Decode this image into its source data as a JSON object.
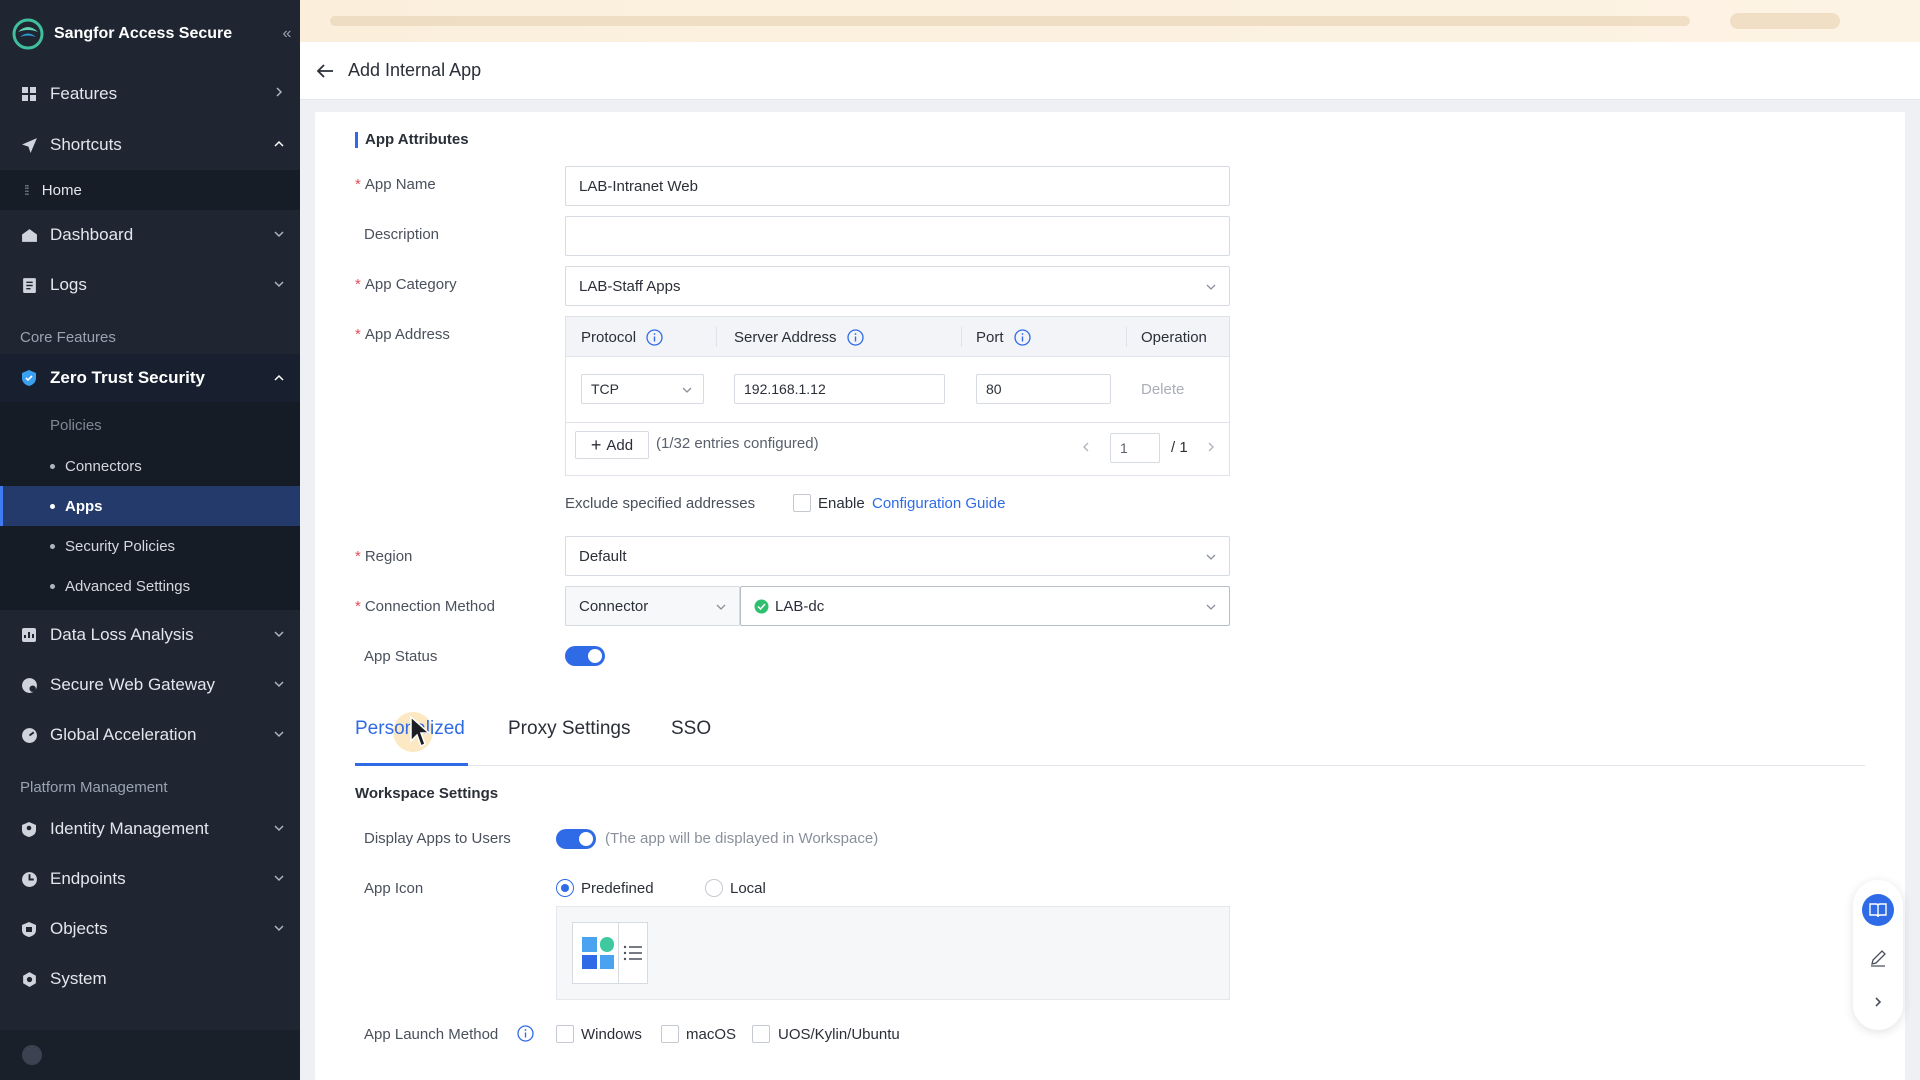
{
  "app": {
    "brand": "Sangfor Access Secure"
  },
  "sidebar": {
    "features": "Features",
    "shortcuts": "Shortcuts",
    "home": "Home",
    "dashboard": "Dashboard",
    "logs": "Logs",
    "core_section": "Core Features",
    "zero_trust": "Zero Trust Security",
    "policies": "Policies",
    "connectors": "Connectors",
    "apps": "Apps",
    "security_policies": "Security Policies",
    "advanced_settings": "Advanced Settings",
    "data_loss": "Data Loss Analysis",
    "swg": "Secure Web Gateway",
    "global_accel": "Global Acceleration",
    "platform_section": "Platform Management",
    "identity": "Identity Management",
    "endpoints": "Endpoints",
    "objects": "Objects",
    "system": "System"
  },
  "header": {
    "title": "Add Internal App"
  },
  "form": {
    "section_title": "App Attributes",
    "app_name_label": "App Name",
    "app_name_value": "LAB-Intranet Web",
    "description_label": "Description",
    "description_value": "",
    "category_label": "App Category",
    "category_value": "LAB-Staff Apps",
    "address_label": "App Address",
    "table_headers": {
      "protocol": "Protocol",
      "server_address": "Server Address",
      "port": "Port",
      "operation": "Operation"
    },
    "row": {
      "protocol": "TCP",
      "server_address": "192.168.1.12",
      "port": "80",
      "delete": "Delete"
    },
    "add_label": "Add",
    "entries_text": "(1/32 entries configured)",
    "page_current": "1",
    "page_total": "/ 1",
    "exclude_label": "Exclude specified addresses",
    "enable_label": "Enable",
    "config_guide": "Configuration Guide",
    "region_label": "Region",
    "region_value": "Default",
    "conn_method_label": "Connection Method",
    "conn_method_value": "Connector",
    "connector_value": "LAB-dc",
    "app_status_label": "App Status"
  },
  "tabs": [
    "Personalized",
    "Proxy Settings",
    "SSO"
  ],
  "workspace": {
    "title": "Workspace Settings",
    "display_label": "Display Apps to Users",
    "display_hint": "(The app will be displayed in Workspace)",
    "icon_label": "App Icon",
    "predefined": "Predefined",
    "local": "Local",
    "launch_label": "App Launch Method",
    "os_windows": "Windows",
    "os_macos": "macOS",
    "os_linux": "UOS/Kylin/Ubuntu"
  },
  "colors": {
    "accent": "#2f6be6",
    "sidebar_bg": "#1f2632",
    "active_item": "#243a6b",
    "required": "#e34d59"
  }
}
